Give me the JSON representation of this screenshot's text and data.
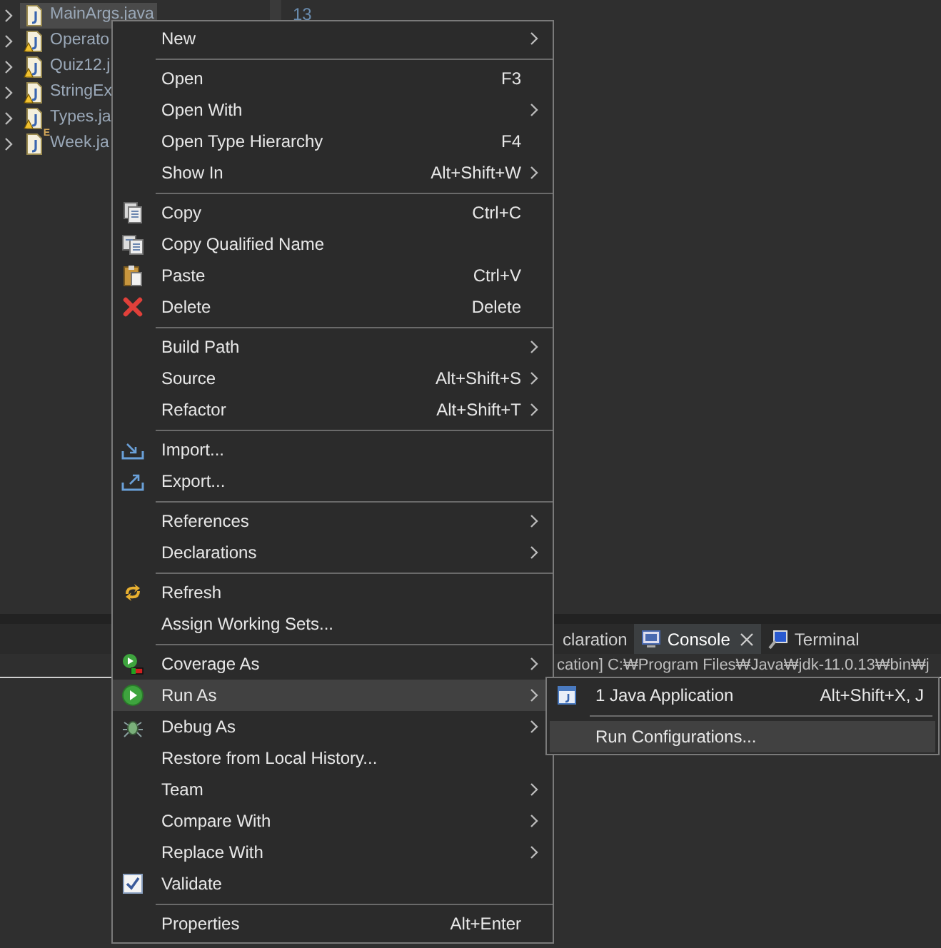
{
  "explorer": {
    "items": [
      {
        "label": "MainArgs.java",
        "selected": true,
        "warning": false
      },
      {
        "label": "Operato",
        "selected": false,
        "warning": true
      },
      {
        "label": "Quiz12.j",
        "selected": false,
        "warning": true
      },
      {
        "label": "StringEx",
        "selected": false,
        "warning": true
      },
      {
        "label": "Types.ja",
        "selected": false,
        "warning": true
      },
      {
        "label": "Week.ja",
        "selected": false,
        "warning": false,
        "badge": "E"
      }
    ]
  },
  "editor": {
    "line_number": "13"
  },
  "bottom_panel": {
    "tabs": [
      {
        "label": "claration",
        "selected": false,
        "closable": false
      },
      {
        "label": "Console",
        "selected": true,
        "closable": true
      },
      {
        "label": "Terminal",
        "selected": false,
        "closable": false
      }
    ],
    "console_header": "cation] C:₩Program Files₩Java₩jdk-11.0.13₩bin₩j"
  },
  "context_menu": {
    "items": [
      {
        "kind": "item",
        "label": "New",
        "submenu": true,
        "selected": false
      },
      {
        "kind": "separator"
      },
      {
        "kind": "item",
        "label": "Open",
        "shortcut": "F3",
        "submenu": false,
        "selected": false
      },
      {
        "kind": "item",
        "label": "Open With",
        "submenu": true,
        "selected": false
      },
      {
        "kind": "item",
        "label": "Open Type Hierarchy",
        "shortcut": "F4",
        "submenu": false,
        "selected": false
      },
      {
        "kind": "item",
        "label": "Show In",
        "shortcut": "Alt+Shift+W",
        "submenu": true,
        "selected": false
      },
      {
        "kind": "separator"
      },
      {
        "kind": "item",
        "label": "Copy",
        "shortcut": "Ctrl+C",
        "submenu": false,
        "selected": false
      },
      {
        "kind": "item",
        "label": "Copy Qualified Name",
        "submenu": false,
        "selected": false
      },
      {
        "kind": "item",
        "label": "Paste",
        "shortcut": "Ctrl+V",
        "submenu": false,
        "selected": false
      },
      {
        "kind": "item",
        "label": "Delete",
        "shortcut": "Delete",
        "submenu": false,
        "selected": false
      },
      {
        "kind": "separator"
      },
      {
        "kind": "item",
        "label": "Build Path",
        "submenu": true,
        "selected": false
      },
      {
        "kind": "item",
        "label": "Source",
        "shortcut": "Alt+Shift+S",
        "submenu": true,
        "selected": false
      },
      {
        "kind": "item",
        "label": "Refactor",
        "shortcut": "Alt+Shift+T",
        "submenu": true,
        "selected": false
      },
      {
        "kind": "separator"
      },
      {
        "kind": "item",
        "label": "Import...",
        "submenu": false,
        "selected": false
      },
      {
        "kind": "item",
        "label": "Export...",
        "submenu": false,
        "selected": false
      },
      {
        "kind": "separator"
      },
      {
        "kind": "item",
        "label": "References",
        "submenu": true,
        "selected": false
      },
      {
        "kind": "item",
        "label": "Declarations",
        "submenu": true,
        "selected": false
      },
      {
        "kind": "separator"
      },
      {
        "kind": "item",
        "label": "Refresh",
        "submenu": false,
        "selected": false
      },
      {
        "kind": "item",
        "label": "Assign Working Sets...",
        "submenu": false,
        "selected": false
      },
      {
        "kind": "separator"
      },
      {
        "kind": "item",
        "label": "Coverage As",
        "submenu": true,
        "selected": false
      },
      {
        "kind": "item",
        "label": "Run As",
        "submenu": true,
        "selected": true
      },
      {
        "kind": "item",
        "label": "Debug As",
        "submenu": true,
        "selected": false
      },
      {
        "kind": "item",
        "label": "Restore from Local History...",
        "submenu": false,
        "selected": false
      },
      {
        "kind": "item",
        "label": "Team",
        "submenu": true,
        "selected": false
      },
      {
        "kind": "item",
        "label": "Compare With",
        "submenu": true,
        "selected": false
      },
      {
        "kind": "item",
        "label": "Replace With",
        "submenu": true,
        "selected": false
      },
      {
        "kind": "item",
        "label": "Validate",
        "submenu": false,
        "selected": false
      },
      {
        "kind": "separator"
      },
      {
        "kind": "item",
        "label": "Properties",
        "shortcut": "Alt+Enter",
        "submenu": false,
        "selected": false
      }
    ]
  },
  "submenu": {
    "items": [
      {
        "kind": "item",
        "label": "1 Java Application",
        "shortcut": "Alt+Shift+X, J",
        "selected": false
      },
      {
        "kind": "separator"
      },
      {
        "kind": "item",
        "label": "Run Configurations...",
        "selected": true
      }
    ]
  }
}
